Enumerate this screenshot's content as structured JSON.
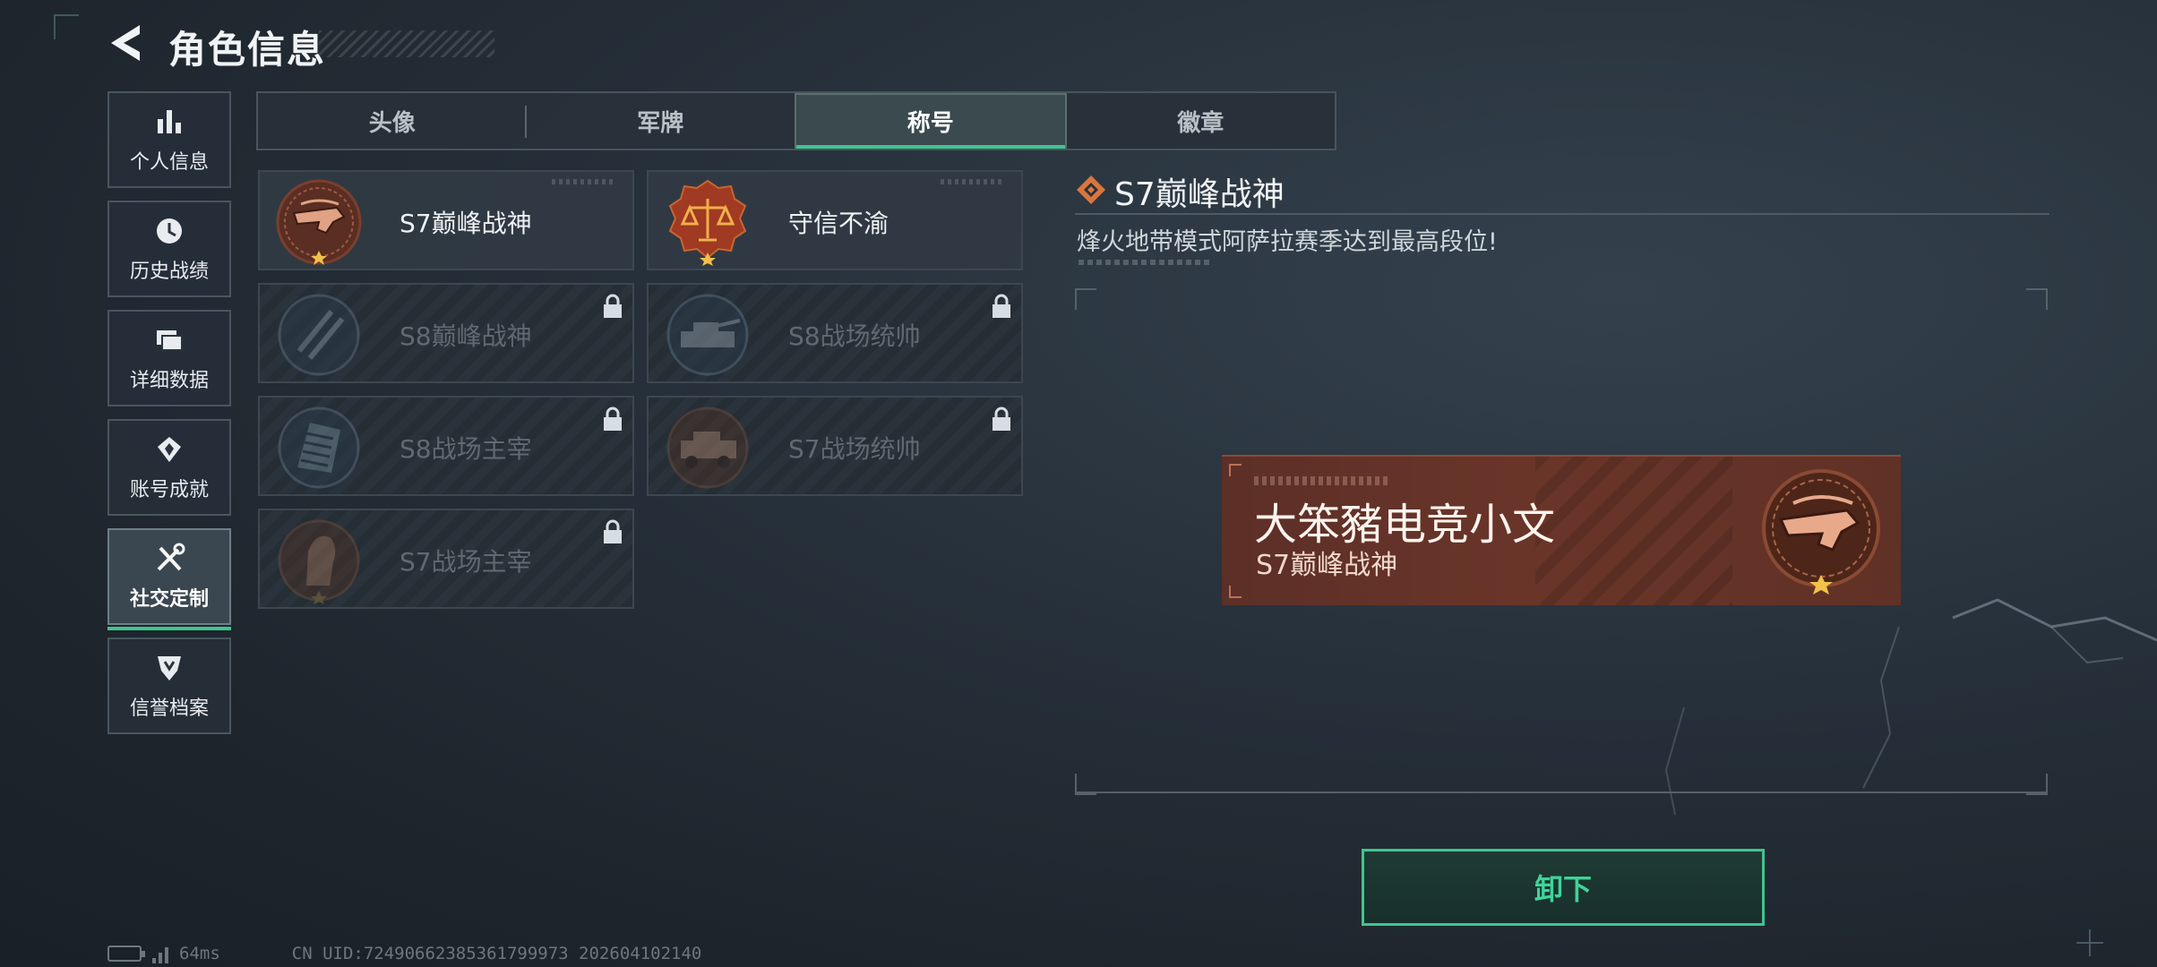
{
  "header": {
    "title": "角色信息"
  },
  "sidebar": {
    "items": [
      {
        "label": "个人信息",
        "icon": "bar-chart-icon"
      },
      {
        "label": "历史战绩",
        "icon": "clock-icon"
      },
      {
        "label": "详细数据",
        "icon": "folder-icon"
      },
      {
        "label": "账号成就",
        "icon": "achievement-icon"
      },
      {
        "label": "社交定制",
        "icon": "wrench-screwdriver-icon",
        "active": true
      },
      {
        "label": "信誉档案",
        "icon": "shield-icon"
      }
    ]
  },
  "tabs": [
    {
      "label": "头像"
    },
    {
      "label": "军牌"
    },
    {
      "label": "称号",
      "active": true
    },
    {
      "label": "徽章"
    }
  ],
  "titles": [
    {
      "name": "S7巅峰战神",
      "locked": false,
      "medal": "crossbow-medal-icon"
    },
    {
      "name": "守信不渝",
      "locked": false,
      "medal": "scales-medal-icon"
    },
    {
      "name": "S8巅峰战神",
      "locked": true,
      "medal": "emblem-medal-icon"
    },
    {
      "name": "S8战场统帅",
      "locked": true,
      "medal": "tank-medal-icon"
    },
    {
      "name": "S8战场主宰",
      "locked": true,
      "medal": "building-medal-icon"
    },
    {
      "name": "S7战场统帅",
      "locked": true,
      "medal": "vehicle-medal-icon"
    },
    {
      "name": "S7战场主宰",
      "locked": true,
      "medal": "soldier-medal-icon"
    }
  ],
  "detail": {
    "title": "S7巅峰战神",
    "description": "烽火地带模式阿萨拉赛季达到最高段位!"
  },
  "preview": {
    "player_name": "大笨豬电竞小文",
    "title": "S7巅峰战神"
  },
  "actions": {
    "unequip_label": "卸下"
  },
  "footer": {
    "ping": "64ms",
    "uid": "CN UID:72490662385361799973 202604102140"
  },
  "colors": {
    "accent": "#3fc58d",
    "title_card": "#6a3529",
    "medal_copper": "#d98a66"
  }
}
